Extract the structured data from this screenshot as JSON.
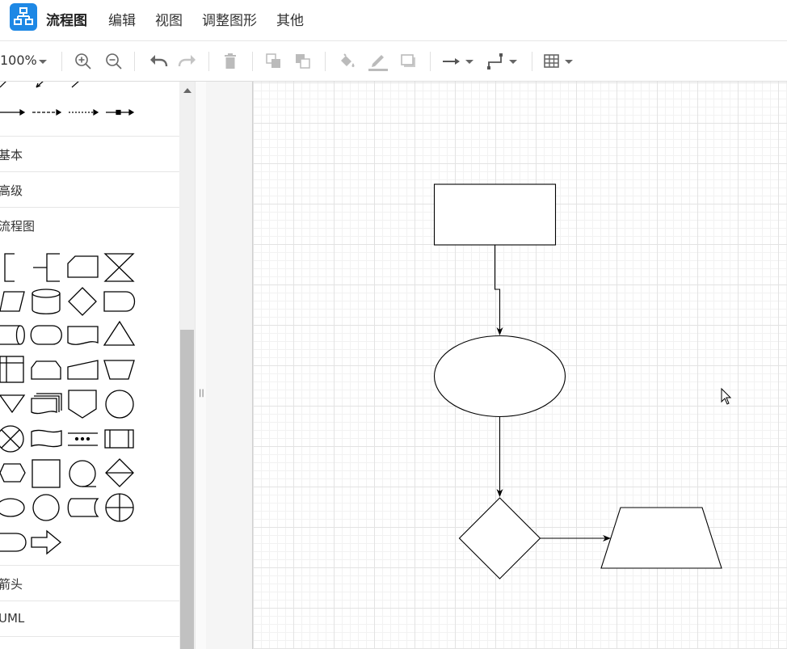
{
  "app": {
    "title": "流程图",
    "logo_icon": "flowchart-app-icon",
    "accent": "#1e88e5"
  },
  "menu": {
    "items": [
      "编辑",
      "视图",
      "调整图形",
      "其他"
    ]
  },
  "toolbar": {
    "zoom": "100%",
    "buttons": [
      "zoom-in-icon",
      "zoom-out-icon",
      "undo-icon",
      "redo-icon",
      "delete-icon",
      "to-front-icon",
      "to-back-icon",
      "fill-color-icon",
      "line-color-icon",
      "shadow-icon",
      "connection-arrow-icon",
      "waypoints-icon",
      "table-icon"
    ]
  },
  "sidebar": {
    "sections": [
      "基本",
      "高级",
      "流程图",
      "箭头",
      "UML"
    ]
  },
  "canvas": {
    "shapes": [
      "rectangle",
      "ellipse",
      "diamond",
      "trapezoid"
    ],
    "connectors": 3
  }
}
